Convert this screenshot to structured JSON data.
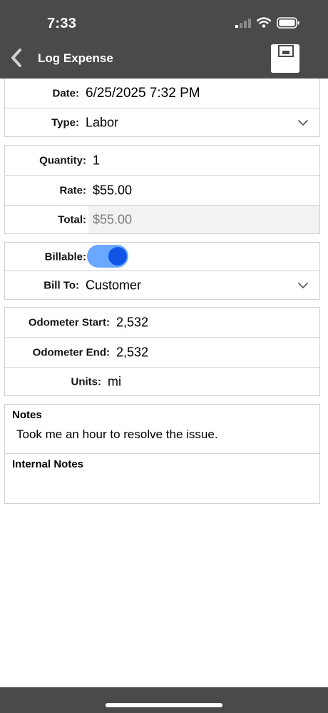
{
  "status_bar": {
    "time": "7:33"
  },
  "nav": {
    "title": "Log Expense"
  },
  "fields": {
    "date": {
      "label": "Date:",
      "value": "6/25/2025 7:32 PM"
    },
    "type": {
      "label": "Type:",
      "value": "Labor"
    },
    "quantity": {
      "label": "Quantity:",
      "value": "1"
    },
    "rate": {
      "label": "Rate:",
      "value": "$55.00"
    },
    "total": {
      "label": "Total:",
      "value": "$55.00"
    },
    "billable": {
      "label": "Billable:",
      "on": true
    },
    "bill_to": {
      "label": "Bill To:",
      "value": "Customer"
    },
    "odometer_start": {
      "label": "Odometer Start:",
      "value": "2,532"
    },
    "odometer_end": {
      "label": "Odometer End:",
      "value": "2,532"
    },
    "units": {
      "label": "Units:",
      "value": "mi"
    }
  },
  "notes": {
    "label": "Notes",
    "value": "Took me an hour to resolve the issue."
  },
  "internal_notes": {
    "label": "Internal Notes",
    "value": ""
  },
  "icons": {
    "back": "chevron-left-icon",
    "save": "save-icon",
    "dropdown": "chevron-down-icon",
    "signal": "cellular-signal-icon",
    "wifi": "wifi-icon",
    "battery": "battery-icon"
  },
  "colors": {
    "header_bg": "#4a4a4a",
    "toggle_track": "#6aa7ff",
    "toggle_knob": "#1155e6"
  }
}
